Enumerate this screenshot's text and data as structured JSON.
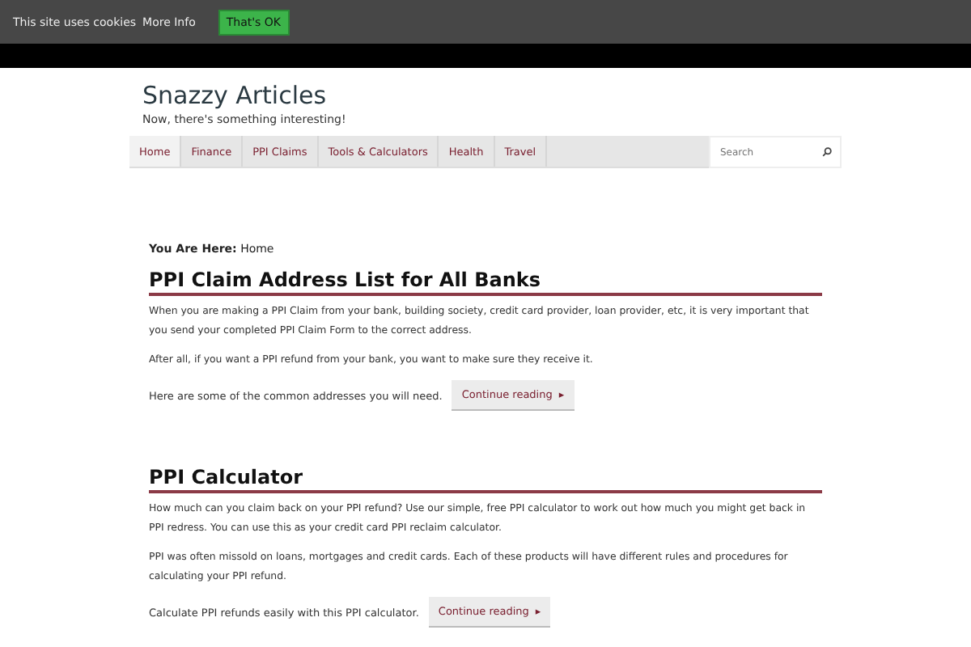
{
  "cookie_bar": {
    "message": "This site uses cookies",
    "link": "More Info",
    "button": "That's OK"
  },
  "site": {
    "title": "Snazzy Articles",
    "tagline": "Now, there's something interesting!"
  },
  "nav": [
    {
      "label": "Home",
      "selected": true
    },
    {
      "label": "Finance",
      "selected": false
    },
    {
      "label": "PPI Claims",
      "selected": false
    },
    {
      "label": "Tools & Calculators",
      "selected": false
    },
    {
      "label": "Health",
      "selected": false
    },
    {
      "label": "Travel",
      "selected": false
    }
  ],
  "search": {
    "placeholder": "Search"
  },
  "breadcrumb": {
    "label": "You Are Here:",
    "current": "Home"
  },
  "posts": [
    {
      "title": "PPI Claim Address List for All Banks",
      "paragraphs": [
        "When you are making a PPI Claim from your bank, building society, credit card provider, loan provider, etc, it is very important that you send your completed PPI Claim Form to the correct address.",
        "After all, if you want a PPI refund from your bank, you want to make sure they receive it."
      ],
      "last_line": "Here are some of the common addresses you will need.",
      "more": "Continue reading",
      "more_arrow": "▸"
    },
    {
      "title": "PPI Calculator",
      "paragraphs": [
        "How much can you claim back on your PPI refund? Use our simple, free PPI calculator to work out how much you might get back in PPI redress.  You can use this as your credit card PPI reclaim calculator.",
        "PPI was often missold on loans, mortgages and credit cards.  Each of these products will have different rules and procedures for calculating your PPI refund."
      ],
      "last_line": "Calculate PPI refunds easily with this PPI calculator.",
      "more": "Continue reading",
      "more_arrow": "▸"
    }
  ]
}
